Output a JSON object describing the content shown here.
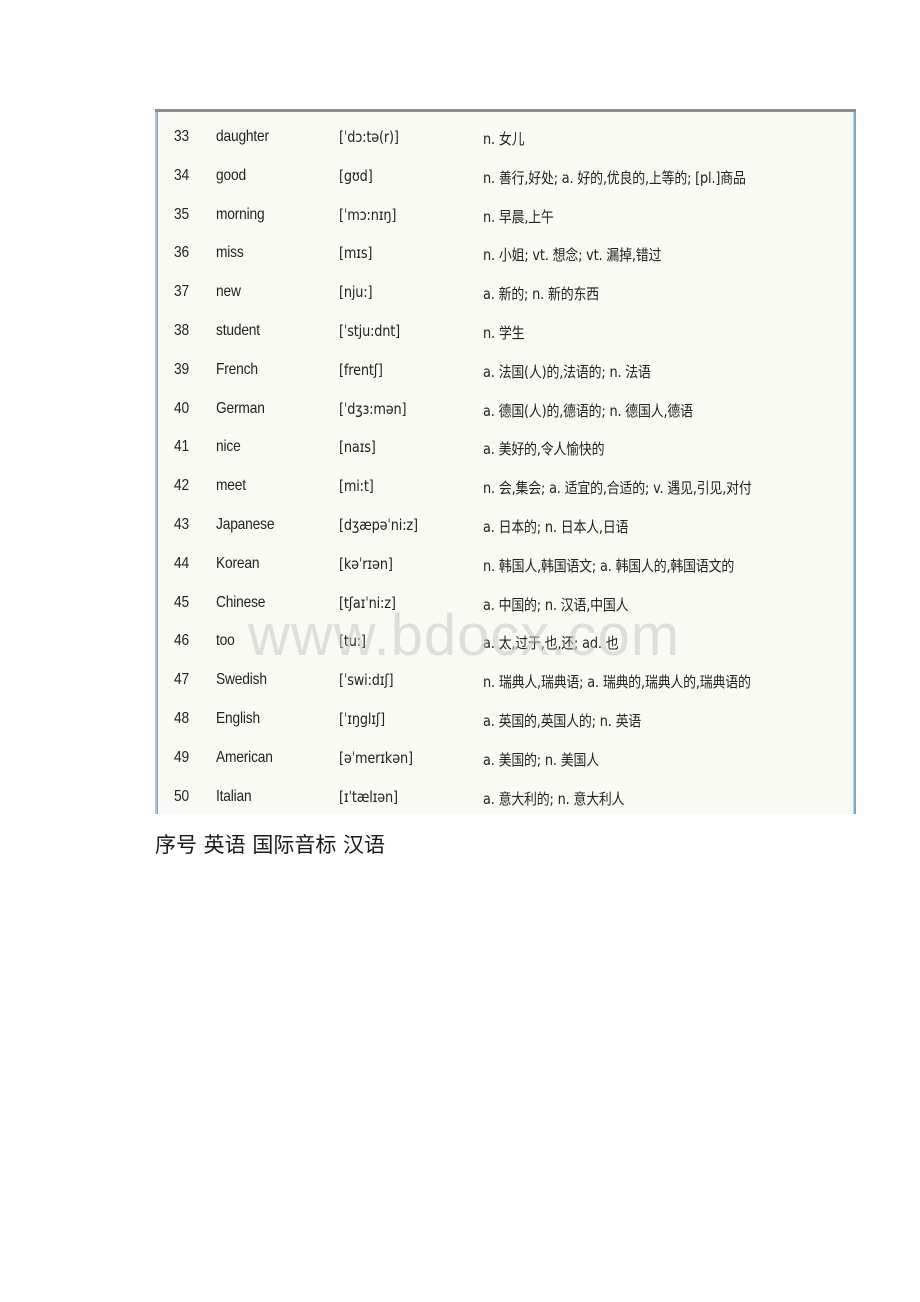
{
  "table": {
    "rows": [
      {
        "num": "33",
        "word": "daughter",
        "ipa": "[ˈdɔ:tə(r)]",
        "cn": "n. 女儿"
      },
      {
        "num": "34",
        "word": "good",
        "ipa": "[gʊd]",
        "cn": "n. 善行,好处; a. 好的,优良的,上等的; [pl.]商品"
      },
      {
        "num": "35",
        "word": "morning",
        "ipa": "[ˈmɔ:nɪŋ]",
        "cn": "n. 早晨,上午"
      },
      {
        "num": "36",
        "word": "miss",
        "ipa": "[mɪs]",
        "cn": "n. 小姐; vt. 想念; vt. 漏掉,错过"
      },
      {
        "num": "37",
        "word": "new",
        "ipa": "[nju:]",
        "cn": "a. 新的; n. 新的东西"
      },
      {
        "num": "38",
        "word": "student",
        "ipa": "[ˈstju:dnt]",
        "cn": "n. 学生"
      },
      {
        "num": "39",
        "word": "French",
        "ipa": "[frentʃ]",
        "cn": "a. 法国(人)的,法语的; n. 法语"
      },
      {
        "num": "40",
        "word": "German",
        "ipa": "[ˈdʒɜ:mən]",
        "cn": "a. 德国(人)的,德语的; n. 德国人,德语"
      },
      {
        "num": "41",
        "word": "nice",
        "ipa": "[naɪs]",
        "cn": "a. 美好的,令人愉快的"
      },
      {
        "num": "42",
        "word": "meet",
        "ipa": "[mi:t]",
        "cn": "n. 会,集会; a. 适宜的,合适的; v. 遇见,引见,对付"
      },
      {
        "num": "43",
        "word": "Japanese",
        "ipa": "[dʒæpəˈni:z]",
        "cn": "a. 日本的; n. 日本人,日语"
      },
      {
        "num": "44",
        "word": "Korean",
        "ipa": "[kəˈrɪən]",
        "cn": "n. 韩国人,韩国语文; a. 韩国人的,韩国语文的"
      },
      {
        "num": "45",
        "word": "Chinese",
        "ipa": "[tʃaɪˈni:z]",
        "cn": "a. 中国的; n. 汉语,中国人"
      },
      {
        "num": "46",
        "word": "too",
        "ipa": "[tu:]",
        "cn": "a. 太,过于,也,还; ad. 也"
      },
      {
        "num": "47",
        "word": "Swedish",
        "ipa": "[ˈswi:dɪʃ]",
        "cn": "n. 瑞典人,瑞典语; a. 瑞典的,瑞典人的,瑞典语的"
      },
      {
        "num": "48",
        "word": "English",
        "ipa": "[ˈɪŋglɪʃ]",
        "cn": "a. 英国的,英国人的; n. 英语"
      },
      {
        "num": "49",
        "word": "American",
        "ipa": "[əˈmerɪkən]",
        "cn": "a. 美国的; n. 美国人"
      },
      {
        "num": "50",
        "word": "Italian",
        "ipa": "[ɪˈtælɪən]",
        "cn": "a. 意大利的; n. 意大利人"
      }
    ]
  },
  "watermark": "www.bdocx.com",
  "caption": "序号 英语 国际音标 汉语"
}
